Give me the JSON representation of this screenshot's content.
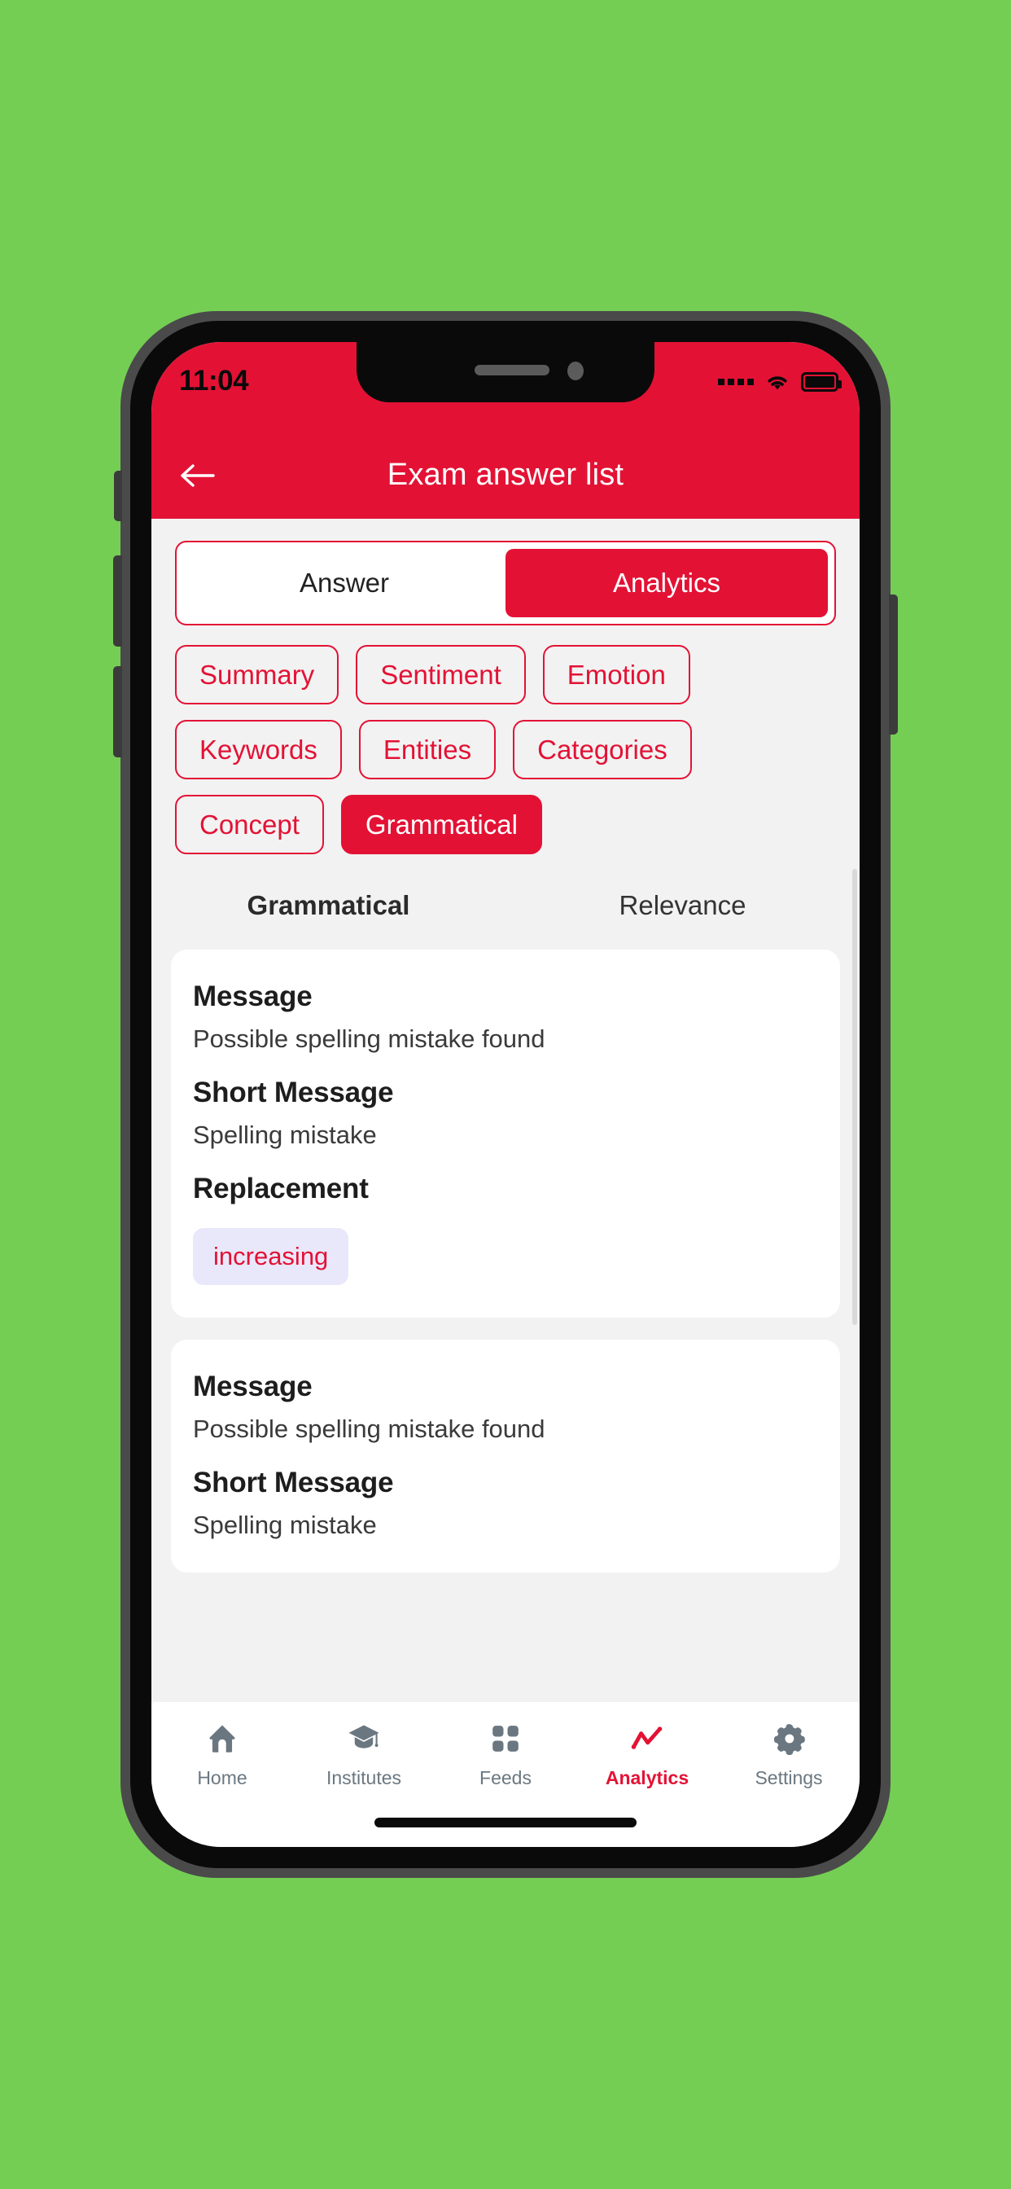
{
  "theme": {
    "background": "#74CE54",
    "accent": "#E31235",
    "surface": "#FFFFFF",
    "body_bg": "#F2F2F2",
    "chip_bg": "#E9E8FA",
    "nav_inactive": "#6B7780"
  },
  "status_bar": {
    "time": "11:04",
    "signal_icon": "signal-dots-icon",
    "wifi_icon": "wifi-icon",
    "battery_icon": "battery-full-icon"
  },
  "app_bar": {
    "back_icon": "arrow-left-icon",
    "title": "Exam answer list"
  },
  "segmented": {
    "options": [
      {
        "label": "Answer",
        "active": false
      },
      {
        "label": "Analytics",
        "active": true
      }
    ]
  },
  "chips": [
    {
      "label": "Summary",
      "active": false
    },
    {
      "label": "Sentiment",
      "active": false
    },
    {
      "label": "Emotion",
      "active": false
    },
    {
      "label": "Keywords",
      "active": false
    },
    {
      "label": "Entities",
      "active": false
    },
    {
      "label": "Categories",
      "active": false
    },
    {
      "label": "Concept",
      "active": false
    },
    {
      "label": "Grammatical",
      "active": true
    }
  ],
  "sub_tabs": [
    {
      "label": "Grammatical",
      "active": true
    },
    {
      "label": "Relevance",
      "active": false
    }
  ],
  "cards": [
    {
      "message_label": "Message",
      "message_value": "Possible spelling mistake found",
      "short_label": "Short Message",
      "short_value": "Spelling mistake",
      "replacement_label": "Replacement",
      "replacement_value": "increasing"
    },
    {
      "message_label": "Message",
      "message_value": "Possible spelling mistake found",
      "short_label": "Short Message",
      "short_value": "Spelling mistake"
    }
  ],
  "bottom_nav": [
    {
      "label": "Home",
      "icon": "home-icon",
      "active": false
    },
    {
      "label": "Institutes",
      "icon": "graduation-cap-icon",
      "active": false
    },
    {
      "label": "Feeds",
      "icon": "grid-icon",
      "active": false
    },
    {
      "label": "Analytics",
      "icon": "line-chart-icon",
      "active": true
    },
    {
      "label": "Settings",
      "icon": "gear-icon",
      "active": false
    }
  ]
}
